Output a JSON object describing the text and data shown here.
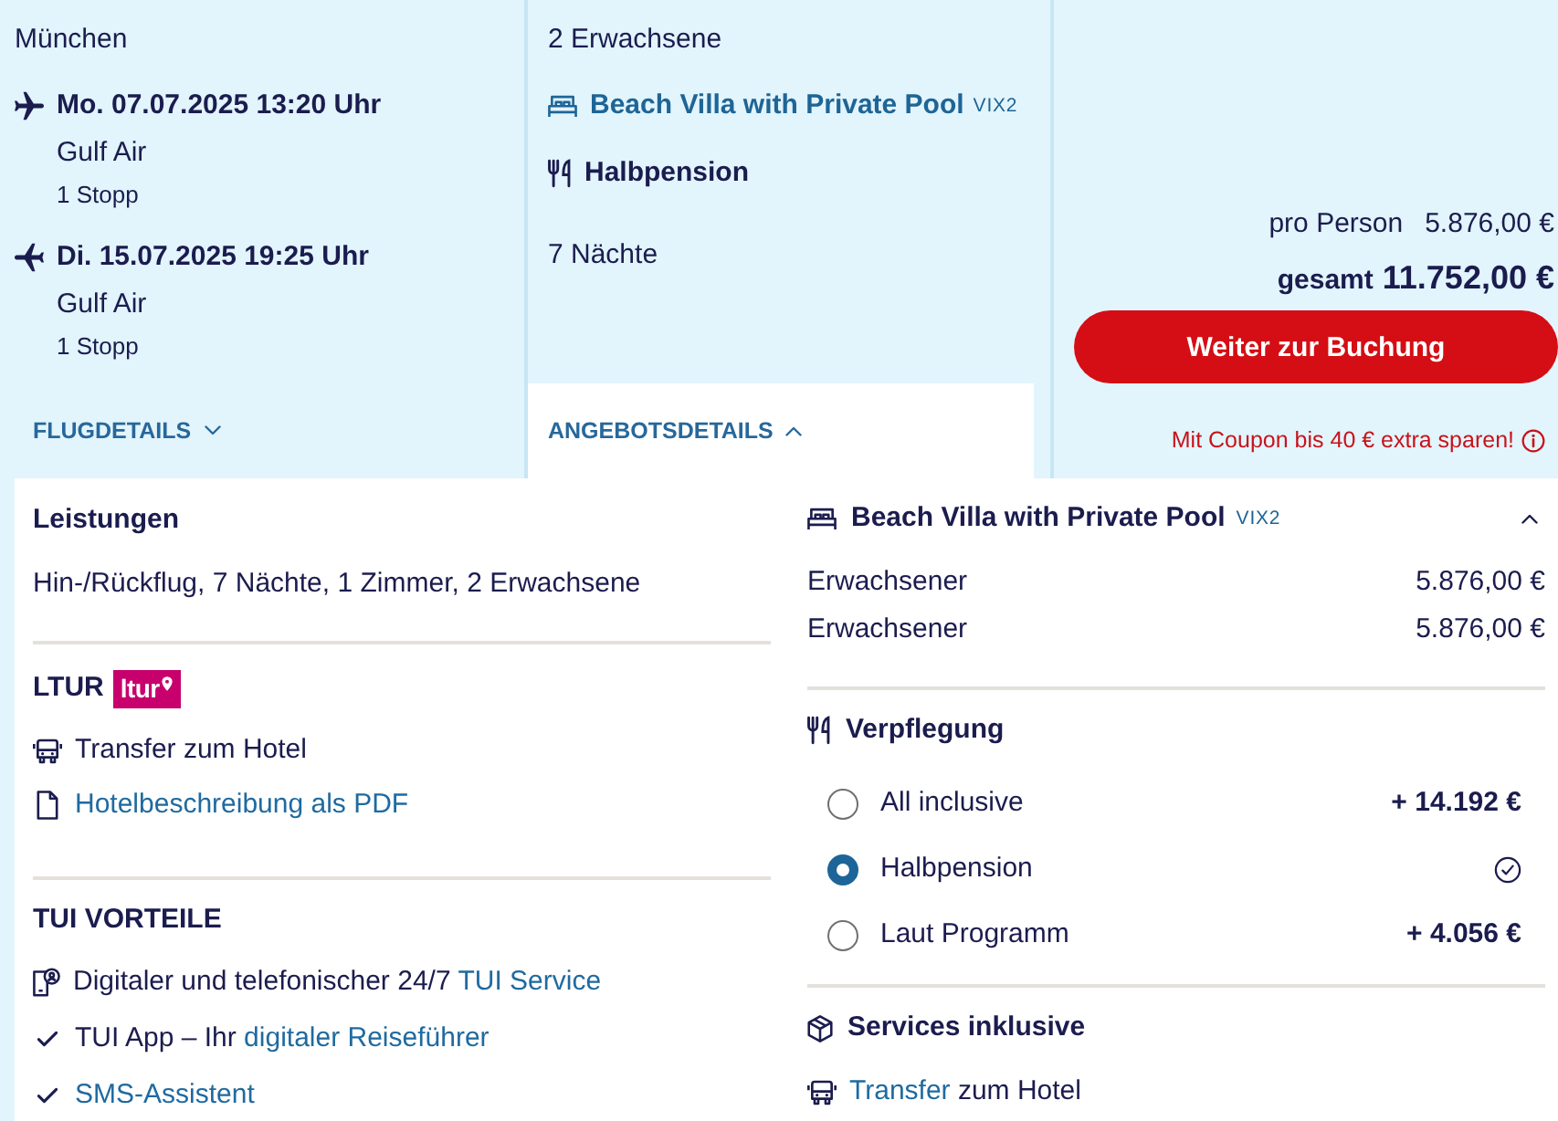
{
  "flight": {
    "origin": "München",
    "legs": [
      {
        "kind": "outbound",
        "date": "Mo. 07.07.2025 13:20 Uhr",
        "airline": "Gulf Air",
        "stops": "1 Stopp"
      },
      {
        "kind": "return",
        "date": "Di. 15.07.2025 19:25 Uhr",
        "airline": "Gulf Air",
        "stops": "1 Stopp"
      }
    ],
    "details_toggle": {
      "label": "FLUGDETAILS",
      "expanded": false
    }
  },
  "offer": {
    "travellers": "2 Erwachsene",
    "room": {
      "name": "Beach Villa with Private Pool",
      "code": "VIX2"
    },
    "board": "Halbpension",
    "nights": "7 Nächte",
    "details_toggle": {
      "label": "ANGEBOTSDETAILS",
      "expanded": true
    }
  },
  "price": {
    "per_person_label": "pro Person",
    "per_person": "5.876,00 €",
    "total_label": "gesamt",
    "total": "11.752,00 €",
    "book_button": "Weiter zur Buchung",
    "coupon_note": "Mit Coupon bis 40 € extra sparen!"
  },
  "services": {
    "title": "Leistungen",
    "summary": "Hin-/Rückflug, 7 Nächte, 1 Zimmer, 2 Erwachsene"
  },
  "operator": {
    "title": "LTUR",
    "logo": "ltur",
    "items": [
      {
        "kind": "transfer",
        "parts": [
          {
            "text": "Transfer zum Hotel",
            "link": false
          }
        ]
      },
      {
        "kind": "document",
        "parts": [
          {
            "text": "Hotelbeschreibung als PDF",
            "link": true
          }
        ]
      }
    ]
  },
  "benefits": {
    "title": "TUI VORTEILE",
    "items": [
      {
        "kind": "support",
        "parts": [
          {
            "text": "Digitaler und telefonischer 24/7 ",
            "link": false
          },
          {
            "text": "TUI Service",
            "link": true
          }
        ]
      },
      {
        "kind": "check",
        "parts": [
          {
            "text": "TUI App – Ihr ",
            "link": false
          },
          {
            "text": "digitaler Reiseführer",
            "link": true
          }
        ]
      },
      {
        "kind": "check",
        "parts": [
          {
            "text": "SMS-Assistent",
            "link": true
          }
        ]
      }
    ]
  },
  "room_prices": {
    "name": "Beach Villa with Private Pool",
    "code": "VIX2",
    "expanded": true,
    "lines": [
      {
        "label": "Erwachsener",
        "price": "5.876,00 €"
      },
      {
        "label": "Erwachsener",
        "price": "5.876,00 €"
      }
    ]
  },
  "meals": {
    "title": "Verpflegung",
    "options": [
      {
        "label": "All inclusive",
        "price": "+ 14.192 €",
        "selected": false
      },
      {
        "label": "Halbpension",
        "selected": true
      },
      {
        "label": "Laut Programm",
        "price": "+ 4.056 €",
        "selected": false
      }
    ]
  },
  "included": {
    "title": "Services inklusive",
    "items": [
      {
        "kind": "transfer",
        "parts": [
          {
            "text": "Transfer",
            "link": true
          },
          {
            "text": " zum Hotel",
            "link": false
          }
        ]
      }
    ]
  }
}
